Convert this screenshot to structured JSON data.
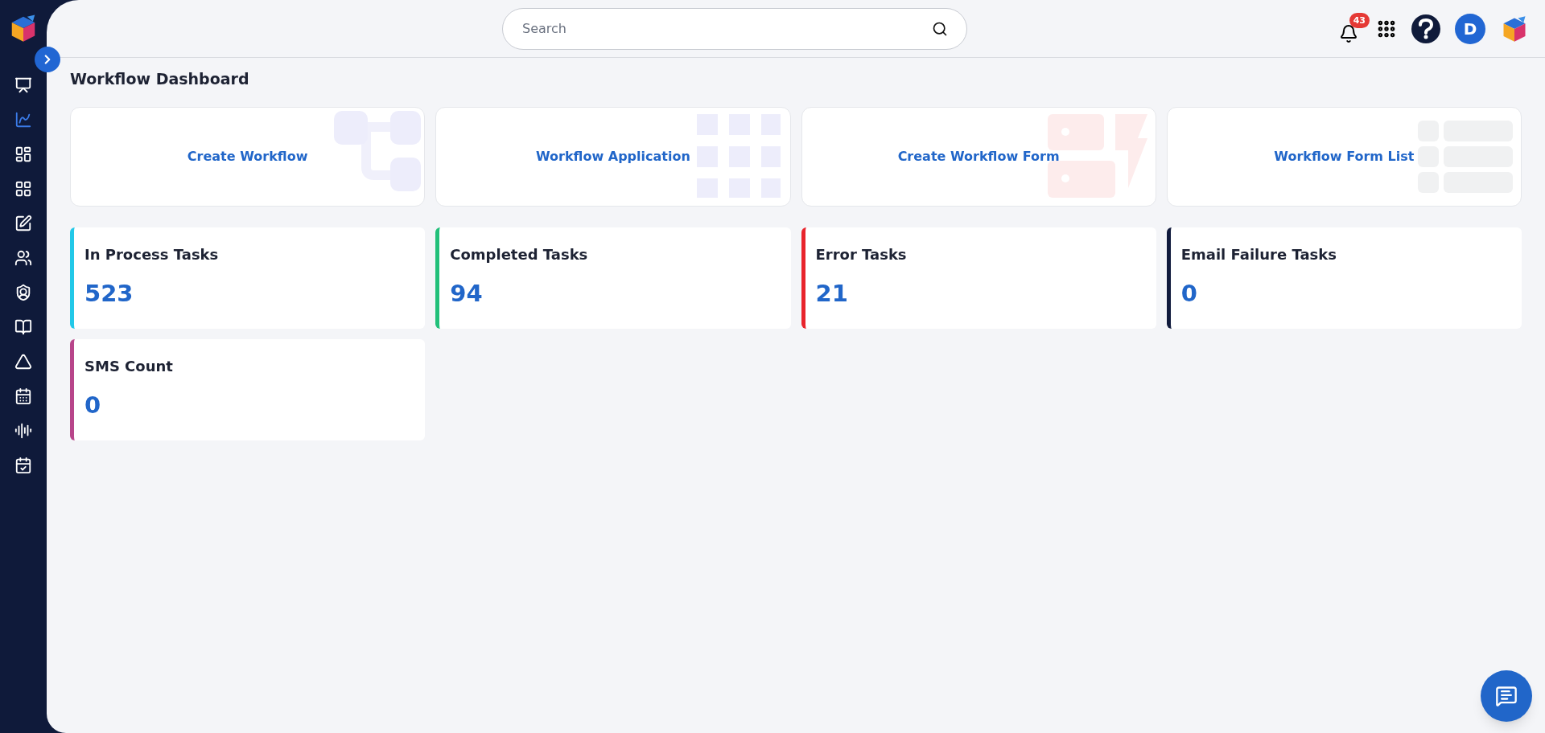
{
  "sidebar": {
    "items": [
      {
        "kind": "monitor",
        "selected": false
      },
      {
        "kind": "chart",
        "selected": true
      },
      {
        "kind": "dashboard",
        "selected": false
      },
      {
        "kind": "widgets",
        "selected": false
      },
      {
        "kind": "edit",
        "selected": false
      },
      {
        "kind": "users",
        "selected": false
      },
      {
        "kind": "shield",
        "selected": false
      },
      {
        "kind": "book",
        "selected": false
      },
      {
        "kind": "drive",
        "selected": false
      },
      {
        "kind": "calendar",
        "selected": false
      },
      {
        "kind": "audio",
        "selected": false
      },
      {
        "kind": "schedule",
        "selected": false
      }
    ]
  },
  "header": {
    "search": {
      "placeholder": "Search"
    },
    "notifications": {
      "count": "43"
    },
    "avatar": {
      "initial": "D"
    }
  },
  "page_title": "Workflow Dashboard",
  "action_cards": [
    {
      "label": "Create Workflow",
      "kind": "flow"
    },
    {
      "label": "Workflow Application",
      "kind": "grid"
    },
    {
      "label": "Create Workflow Form",
      "kind": "form"
    },
    {
      "label": "Workflow Form List",
      "kind": "list"
    }
  ],
  "stat_cards": [
    {
      "title": "In Process Tasks",
      "value": "523",
      "color": "#22c8e8"
    },
    {
      "title": "Completed Tasks",
      "value": "94",
      "color": "#22c07a"
    },
    {
      "title": "Error Tasks",
      "value": "21",
      "color": "#e8242c"
    },
    {
      "title": "Email Failure Tasks",
      "value": "0",
      "color": "#101a3c"
    },
    {
      "title": "SMS Count",
      "value": "0",
      "color": "#b8458a"
    }
  ]
}
